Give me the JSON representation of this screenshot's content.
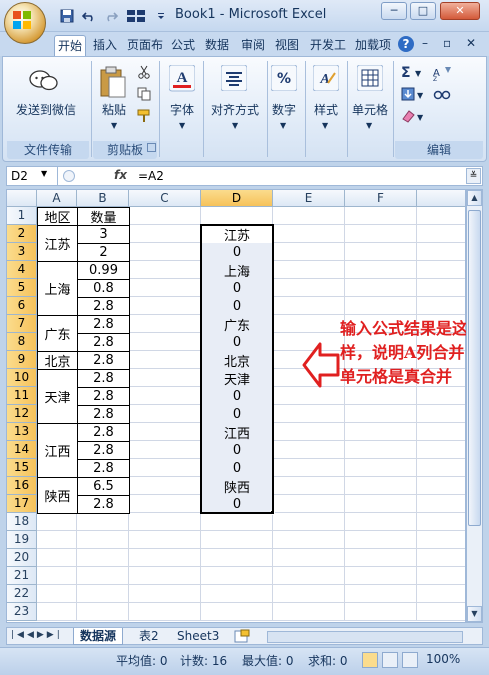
{
  "window": {
    "title": "Book1 - Microsoft Excel",
    "minimize": "─",
    "restore": "□",
    "close": "✕"
  },
  "ribbon_tabs": [
    "开始",
    "插入",
    "页面布",
    "公式",
    "数据",
    "审阅",
    "视图",
    "开发工",
    "加载项"
  ],
  "ribbon_controls": {
    "help": "?",
    "minimize": "–",
    "restore": "▫",
    "close": "✕"
  },
  "groups": {
    "file_transfer": {
      "label": "文件传输",
      "button": "发送到微信"
    },
    "clipboard": {
      "label": "剪贴板",
      "paste": "粘贴"
    },
    "font": {
      "button": "字体"
    },
    "alignment": {
      "button": "对齐方式"
    },
    "number": {
      "button": "数字"
    },
    "styles": {
      "button": "样式"
    },
    "cells": {
      "button": "单元格"
    },
    "editing": {
      "label": "编辑"
    }
  },
  "formula_bar": {
    "name_box": "D2",
    "fx": "fx",
    "formula": "=A2"
  },
  "columns": [
    "A",
    "B",
    "C",
    "D",
    "E",
    "F"
  ],
  "rows": [
    "1",
    "2",
    "3",
    "4",
    "5",
    "6",
    "7",
    "8",
    "9",
    "10",
    "11",
    "12",
    "13",
    "14",
    "15",
    "16",
    "17",
    "18",
    "19",
    "20",
    "21",
    "22",
    "23"
  ],
  "table": {
    "header_a": "地区",
    "header_b": "数量",
    "merged_a": [
      {
        "text": "江苏",
        "start": 2,
        "end": 3
      },
      {
        "text": "上海",
        "start": 4,
        "end": 6
      },
      {
        "text": "广东",
        "start": 7,
        "end": 8
      },
      {
        "text": "北京",
        "start": 9,
        "end": 9
      },
      {
        "text": "天津",
        "start": 10,
        "end": 12
      },
      {
        "text": "江西",
        "start": 13,
        "end": 15
      },
      {
        "text": "陕西",
        "start": 16,
        "end": 17
      }
    ],
    "column_b": [
      "3",
      "2",
      "0.99",
      "0.8",
      "2.8",
      "2.8",
      "2.8",
      "2.8",
      "2.8",
      "2.8",
      "2.8",
      "2.8",
      "2.8",
      "2.8",
      "6.5",
      "2.8"
    ],
    "column_d": [
      "江苏",
      "0",
      "上海",
      "0",
      "0",
      "广东",
      "0",
      "北京",
      "天津",
      "0",
      "0",
      "江西",
      "0",
      "0",
      "陕西",
      "0"
    ]
  },
  "annotation": "输入公式结果是这样，说明A列合并单元格是真合并",
  "sheet_tabs": [
    "数据源",
    "表2",
    "Sheet3"
  ],
  "status": {
    "average": "平均值: 0",
    "count": "计数: 16",
    "max": "最大值: 0",
    "sum": "求和: 0",
    "zoom": "100%"
  },
  "colors": {
    "annotation": "#e02020",
    "selected_header": "#f6c25a",
    "ribbon": "#c5d8ef"
  }
}
